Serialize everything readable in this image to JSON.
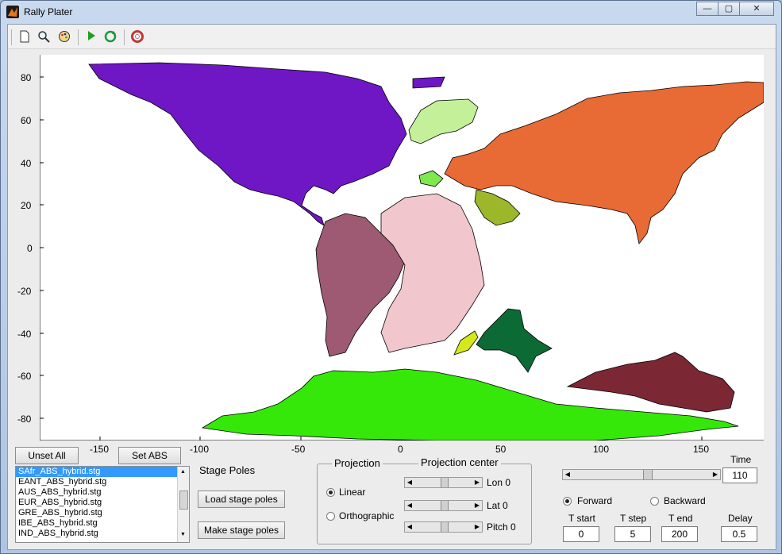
{
  "window": {
    "title": "Rally Plater",
    "minimize": "—",
    "maximize": "▢",
    "close": "✕"
  },
  "toolbar": {
    "items": [
      {
        "name": "new-file-icon",
        "glyph": "🗋"
      },
      {
        "name": "zoom-icon",
        "glyph": "🔍"
      },
      {
        "name": "palette-icon",
        "glyph": "◎"
      },
      {
        "name": "play-icon",
        "glyph": "▶"
      },
      {
        "name": "refresh-icon",
        "glyph": "⟳"
      },
      {
        "name": "help-icon",
        "glyph": "⊕"
      }
    ]
  },
  "plot": {
    "x_ticks": [
      "-150",
      "-100",
      "-50",
      "0",
      "50",
      "100",
      "150"
    ],
    "y_ticks": [
      "80",
      "60",
      "40",
      "20",
      "0",
      "-20",
      "-40",
      "-60",
      "-80"
    ]
  },
  "plates": [
    {
      "name": "North America",
      "color": "#6f17c4"
    },
    {
      "name": "Greenland",
      "color": "#c4f09a"
    },
    {
      "name": "Eurasia",
      "color": "#e86a34"
    },
    {
      "name": "Iberia",
      "color": "#7fe84f"
    },
    {
      "name": "Arabia",
      "color": "#9cb82a"
    },
    {
      "name": "South America",
      "color": "#9e5a72"
    },
    {
      "name": "Africa",
      "color": "#f2c6cd"
    },
    {
      "name": "Madagascar",
      "color": "#d4e81c"
    },
    {
      "name": "India",
      "color": "#0c6a35"
    },
    {
      "name": "Australia",
      "color": "#7c2734"
    },
    {
      "name": "Antarctica",
      "color": "#35e80a"
    }
  ],
  "controls": {
    "unset_all": "Unset All",
    "set_abs": "Set ABS",
    "files": [
      "SAfr_ABS_hybrid.stg",
      "EANT_ABS_hybrid.stg",
      "AUS_ABS_hybrid.stg",
      "EUR_ABS_hybrid.stg",
      "GRE_ABS_hybrid.stg",
      "IBE_ABS_hybrid.stg",
      "IND_ABS_hybrid.stg"
    ],
    "stage_poles": "Stage Poles",
    "load_stage_poles": "Load stage poles",
    "make_stage_poles": "Make stage poles",
    "projection": {
      "label": "Projection",
      "linear": "Linear",
      "orthographic": "Orthographic",
      "selected": "Linear"
    },
    "projection_center": {
      "label": "Projection center",
      "lon_label": "Lon 0",
      "lat_label": "Lat 0",
      "pitch_label": "Pitch 0"
    },
    "time": {
      "label": "Time",
      "value": "110",
      "slider_fraction": 0.55
    },
    "direction": {
      "forward": "Forward",
      "backward": "Backward",
      "selected": "Forward"
    },
    "t_start": {
      "label": "T start",
      "value": "0"
    },
    "t_step": {
      "label": "T step",
      "value": "5"
    },
    "t_end": {
      "label": "T end",
      "value": "200"
    },
    "delay": {
      "label": "Delay",
      "value": "0.5"
    }
  }
}
